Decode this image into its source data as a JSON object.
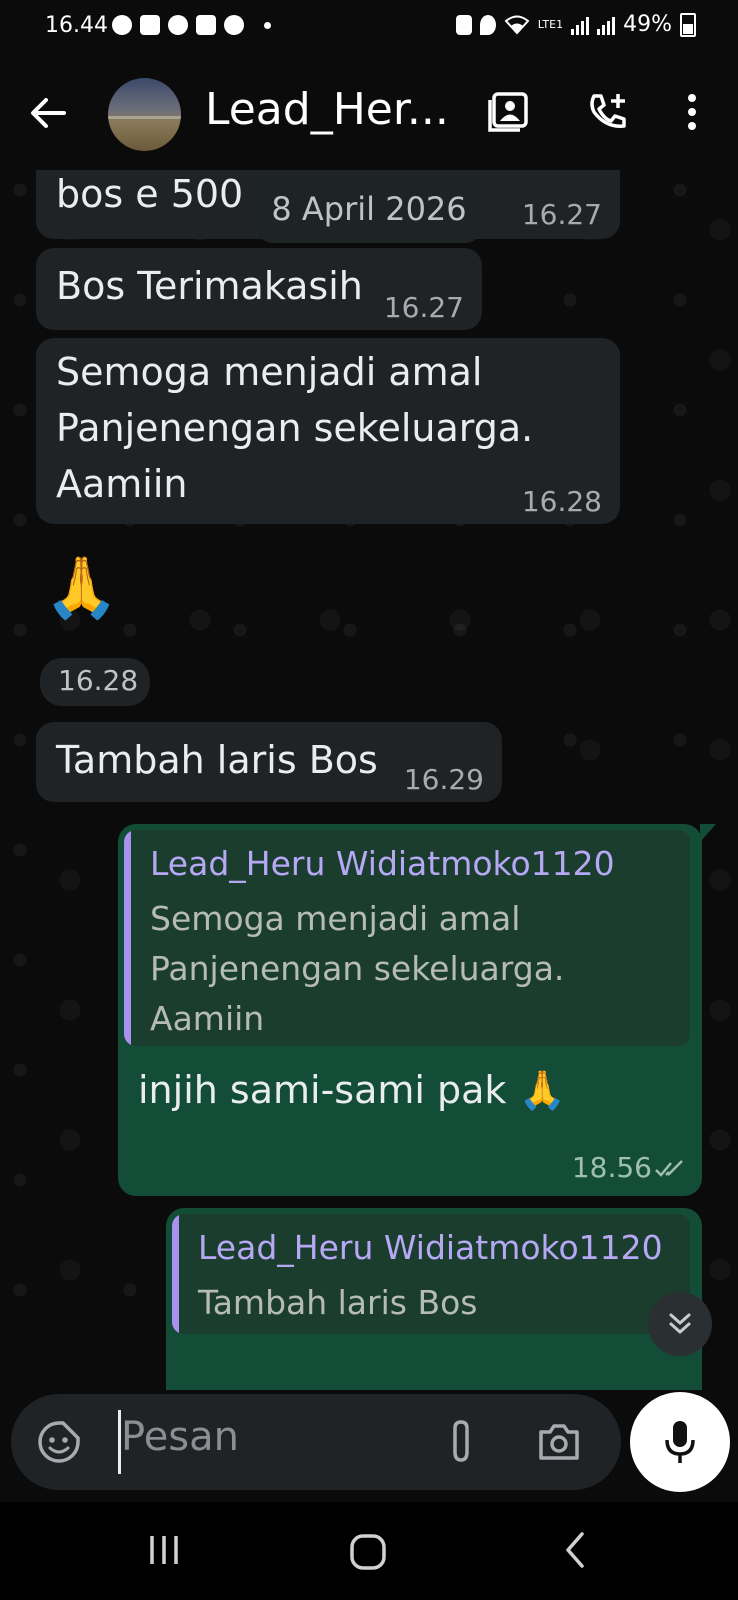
{
  "status_bar": {
    "time": "16.44",
    "battery": "49%",
    "network": "LTE1"
  },
  "header": {
    "contact_name": "Lead_Her..."
  },
  "date_chip": "8 April 2026",
  "messages": [
    {
      "text": "bos e 500",
      "time": "16.27"
    },
    {
      "text": "Bos Terimakasih",
      "time": "16.27"
    },
    {
      "text": "Semoga menjadi amal Panjenengan sekeluarga. Aamiin",
      "time": "16.28"
    },
    {
      "emoji": "🙏",
      "time": "16.28"
    },
    {
      "text": "Tambah laris Bos",
      "time": "16.29"
    }
  ],
  "replies": [
    {
      "quote_name": "Lead_Heru Widiatmoko1120",
      "quote_text": "Semoga menjadi amal Panjenengan sekeluarga. Aamiin",
      "text": "injih sami-sami pak 🙏",
      "time": "18.56"
    },
    {
      "quote_name": "Lead_Heru Widiatmoko1120",
      "quote_text": "Tambah laris Bos"
    }
  ],
  "composer": {
    "placeholder": "Pesan"
  },
  "icons": [
    "back-arrow-icon",
    "contact-card-icon",
    "add-call-icon",
    "more-vert-icon",
    "emoji-sticker-icon",
    "attach-icon",
    "camera-icon",
    "mic-icon",
    "scroll-down-icon",
    "double-check-icon"
  ]
}
